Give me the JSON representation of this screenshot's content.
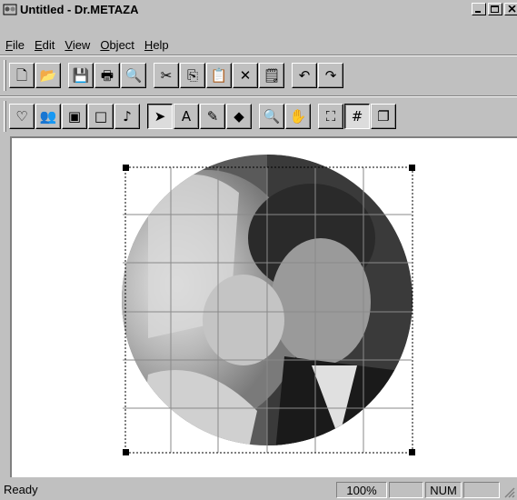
{
  "window": {
    "title": "Untitled - Dr.METAZA",
    "minimize_label": "_",
    "close_label": "×"
  },
  "menu": [
    {
      "key": "F",
      "rest": "ile"
    },
    {
      "key": "E",
      "rest": "dit"
    },
    {
      "key": "V",
      "rest": "iew"
    },
    {
      "key": "O",
      "rest": "bject"
    },
    {
      "key": "H",
      "rest": "elp"
    }
  ],
  "toolbar1": [
    {
      "name": "new-file-icon",
      "glyph": "🗋"
    },
    {
      "name": "open-folder-icon",
      "glyph": "📂"
    },
    {
      "name": "save-disk-icon",
      "glyph": "💾"
    },
    {
      "name": "print-icon",
      "glyph": "🖶"
    },
    {
      "name": "print-preview-icon",
      "glyph": "🔍"
    },
    {
      "name": "cut-scissors-icon",
      "glyph": "✂"
    },
    {
      "name": "copy-icon",
      "glyph": "⎘"
    },
    {
      "name": "paste-icon",
      "glyph": "📋"
    },
    {
      "name": "delete-x-icon",
      "glyph": "✕"
    },
    {
      "name": "properties-icon",
      "glyph": "🗒"
    },
    {
      "name": "undo-icon",
      "glyph": "↶"
    },
    {
      "name": "redo-icon",
      "glyph": "↷"
    }
  ],
  "toolbar2": [
    {
      "name": "heart-shape-icon",
      "glyph": "♡"
    },
    {
      "name": "people-clipart-icon",
      "glyph": "👥"
    },
    {
      "name": "photo-frame-icon",
      "glyph": "▣"
    },
    {
      "name": "blank-frame-icon",
      "glyph": "□"
    },
    {
      "name": "music-note-icon",
      "glyph": "♪"
    },
    {
      "name": "select-arrow-icon",
      "glyph": "➤"
    },
    {
      "name": "text-tool-icon",
      "glyph": "A"
    },
    {
      "name": "pen-tool-icon",
      "glyph": "✎"
    },
    {
      "name": "fill-tool-icon",
      "glyph": "◆"
    },
    {
      "name": "zoom-magnifier-icon",
      "glyph": "🔍"
    },
    {
      "name": "hand-pan-icon",
      "glyph": "✋"
    },
    {
      "name": "fit-window-icon",
      "glyph": "⛶"
    },
    {
      "name": "grid-toggle-icon",
      "glyph": "#"
    },
    {
      "name": "layers-window-icon",
      "glyph": "❐"
    }
  ],
  "status": {
    "text": "Ready",
    "zoom": "100%",
    "num": "NUM",
    "panel_empty_1": "",
    "panel_empty_2": ""
  },
  "colors": {
    "face": "#c0c0c0",
    "shadow": "#808080",
    "highlight": "#ffffff",
    "canvas": "#ffffff"
  }
}
